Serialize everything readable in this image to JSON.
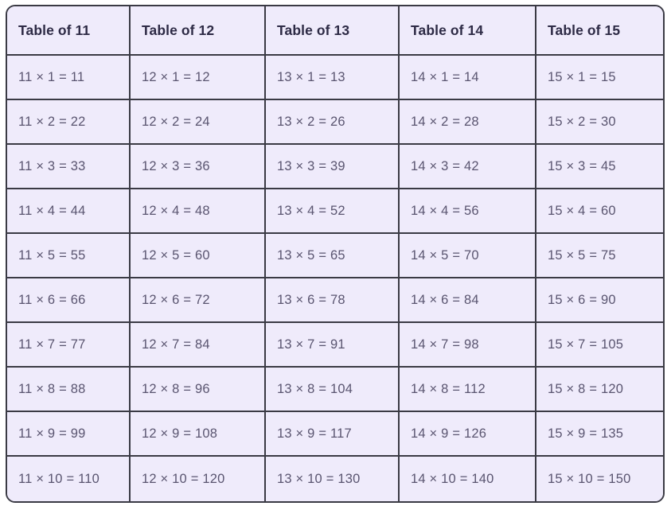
{
  "table": {
    "headers": [
      "Table of 11",
      "Table of 12",
      "Table of 13",
      "Table of 14",
      "Table of 15"
    ],
    "rows": [
      [
        "11 × 1 = 11",
        "12 × 1 = 12",
        "13 × 1 = 13",
        "14 × 1 = 14",
        "15 × 1 = 15"
      ],
      [
        "11 × 2 = 22",
        "12 × 2 = 24",
        "13 × 2 = 26",
        "14 × 2 = 28",
        "15 × 2 = 30"
      ],
      [
        "11 × 3 = 33",
        "12 × 3 = 36",
        "13 × 3 = 39",
        "14 × 3 = 42",
        "15 × 3 = 45"
      ],
      [
        "11 × 4 = 44",
        "12 × 4 = 48",
        "13 × 4 = 52",
        "14 × 4 = 56",
        "15 × 4 = 60"
      ],
      [
        "11 × 5 = 55",
        "12 × 5 = 60",
        "13 × 5 = 65",
        "14 × 5 = 70",
        "15 × 5 = 75"
      ],
      [
        "11 × 6 = 66",
        "12 × 6 = 72",
        "13 × 6 = 78",
        "14 × 6 = 84",
        "15 × 6 = 90"
      ],
      [
        "11 × 7 = 77",
        "12 × 7 = 84",
        "13 × 7 = 91",
        "14 × 7 = 98",
        "15 × 7 = 105"
      ],
      [
        "11 × 8 = 88",
        "12 × 8 = 96",
        "13 × 8 = 104",
        "14 × 8 = 112",
        "15 × 8 = 120"
      ],
      [
        "11 × 9 = 99",
        "12 × 9 = 108",
        "13 × 9 = 117",
        "14 × 9 = 126",
        "15 × 9 = 135"
      ],
      [
        "11 × 10 = 110",
        "12 × 10 = 120",
        "13 × 10 = 130",
        "14 × 10 = 140",
        "15 × 10 = 150"
      ]
    ]
  },
  "colors": {
    "cell_background": "#efebfb",
    "border": "#3a3a44",
    "header_text": "#2d2a45",
    "body_text": "#5a5570",
    "page_background": "#ffffff"
  }
}
